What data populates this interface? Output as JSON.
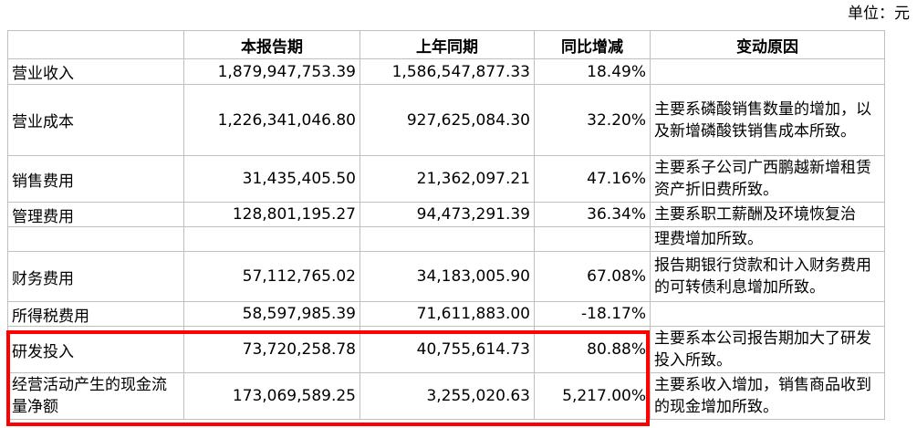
{
  "unit": "单位：元",
  "headers": {
    "item": "",
    "current": "本报告期",
    "previous": "上年同期",
    "change": "同比增减",
    "reason": "变动原因"
  },
  "rows": [
    {
      "name": "营业收入",
      "current": "1,879,947,753.39",
      "previous": "1,586,547,877.33",
      "change": "18.49%",
      "reason": ""
    },
    {
      "name": "营业成本",
      "current": "1,226,341,046.80",
      "previous": "927,625,084.30",
      "change": "32.20%",
      "reason": "主要系磷酸销售数量的增加，以及新增磷酸铁销售成本所致。"
    },
    {
      "name": "销售费用",
      "current": "31,435,405.50",
      "previous": "21,362,097.21",
      "change": "47.16%",
      "reason": "主要系子公司广西鹏越新增租赁资产折旧费所致。"
    },
    {
      "name": "管理费用",
      "current": "128,801,195.27",
      "previous": "94,473,291.39",
      "change": "36.34%",
      "reason": "主要系职工薪酬及环境恢复治"
    },
    {
      "name": "",
      "current": "",
      "previous": "",
      "change": "",
      "reason": "理费增加所致。"
    },
    {
      "name": "财务费用",
      "current": "57,112,765.02",
      "previous": "34,183,005.90",
      "change": "67.08%",
      "reason": "报告期银行贷款和计入财务费用的可转债利息增加所致。"
    },
    {
      "name": "所得税费用",
      "current": "58,597,985.39",
      "previous": "71,611,883.00",
      "change": "-18.17%",
      "reason": ""
    },
    {
      "name": "研发投入",
      "current": "73,720,258.78",
      "previous": "40,755,614.73",
      "change": "80.88%",
      "reason": "主要系本公司报告期加大了研发投入所致。"
    },
    {
      "name": "经营活动产生的现金流量净额",
      "current": "173,069,589.25",
      "previous": "3,255,020.63",
      "change": "5,217.00%",
      "reason": "主要系收入增加，销售商品收到的现金增加所致。"
    }
  ]
}
